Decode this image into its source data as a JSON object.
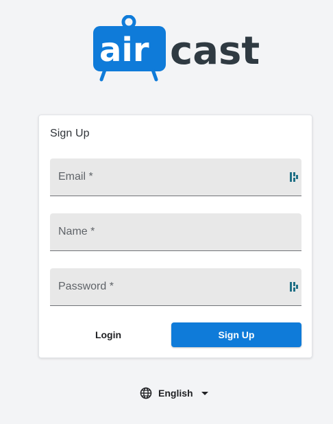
{
  "logo": {
    "text_prefix": "air",
    "text_suffix": "cast"
  },
  "colors": {
    "brand_blue": "#0f7bd9",
    "logo_dark": "#2f3a42",
    "background": "#f3f4f6"
  },
  "card": {
    "title": "Sign Up",
    "fields": {
      "email": {
        "label": "Email *",
        "icon": "password-manager-icon"
      },
      "name": {
        "label": "Name *"
      },
      "password": {
        "label": "Password *",
        "icon": "password-manager-icon"
      }
    },
    "buttons": {
      "login": "Login",
      "signup": "Sign Up"
    }
  },
  "language": {
    "icon": "globe-icon",
    "selected": "English",
    "dropdown_icon": "caret-down-icon"
  }
}
